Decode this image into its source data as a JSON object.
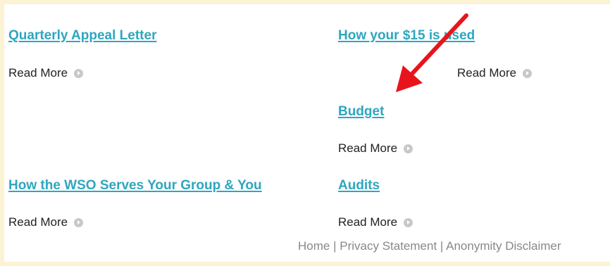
{
  "items": [
    {
      "title": "Quarterly Appeal Letter",
      "read_more": "Read More"
    },
    {
      "title": "How your $15 is used",
      "read_more": "Read More"
    },
    {
      "title": "Budget",
      "read_more": "Read More"
    },
    {
      "title": "How the WSO Serves Your Group & You",
      "read_more": "Read More"
    },
    {
      "title": "Audits",
      "read_more": "Read More"
    }
  ],
  "footer": {
    "home": "Home",
    "sep": " | ",
    "privacy": "Privacy Statement",
    "anonymity": "Anonymity Disclaimer"
  },
  "colors": {
    "link": "#2ea6bf",
    "frame": "#fcf2d4",
    "annotation_arrow": "#e8141c"
  }
}
